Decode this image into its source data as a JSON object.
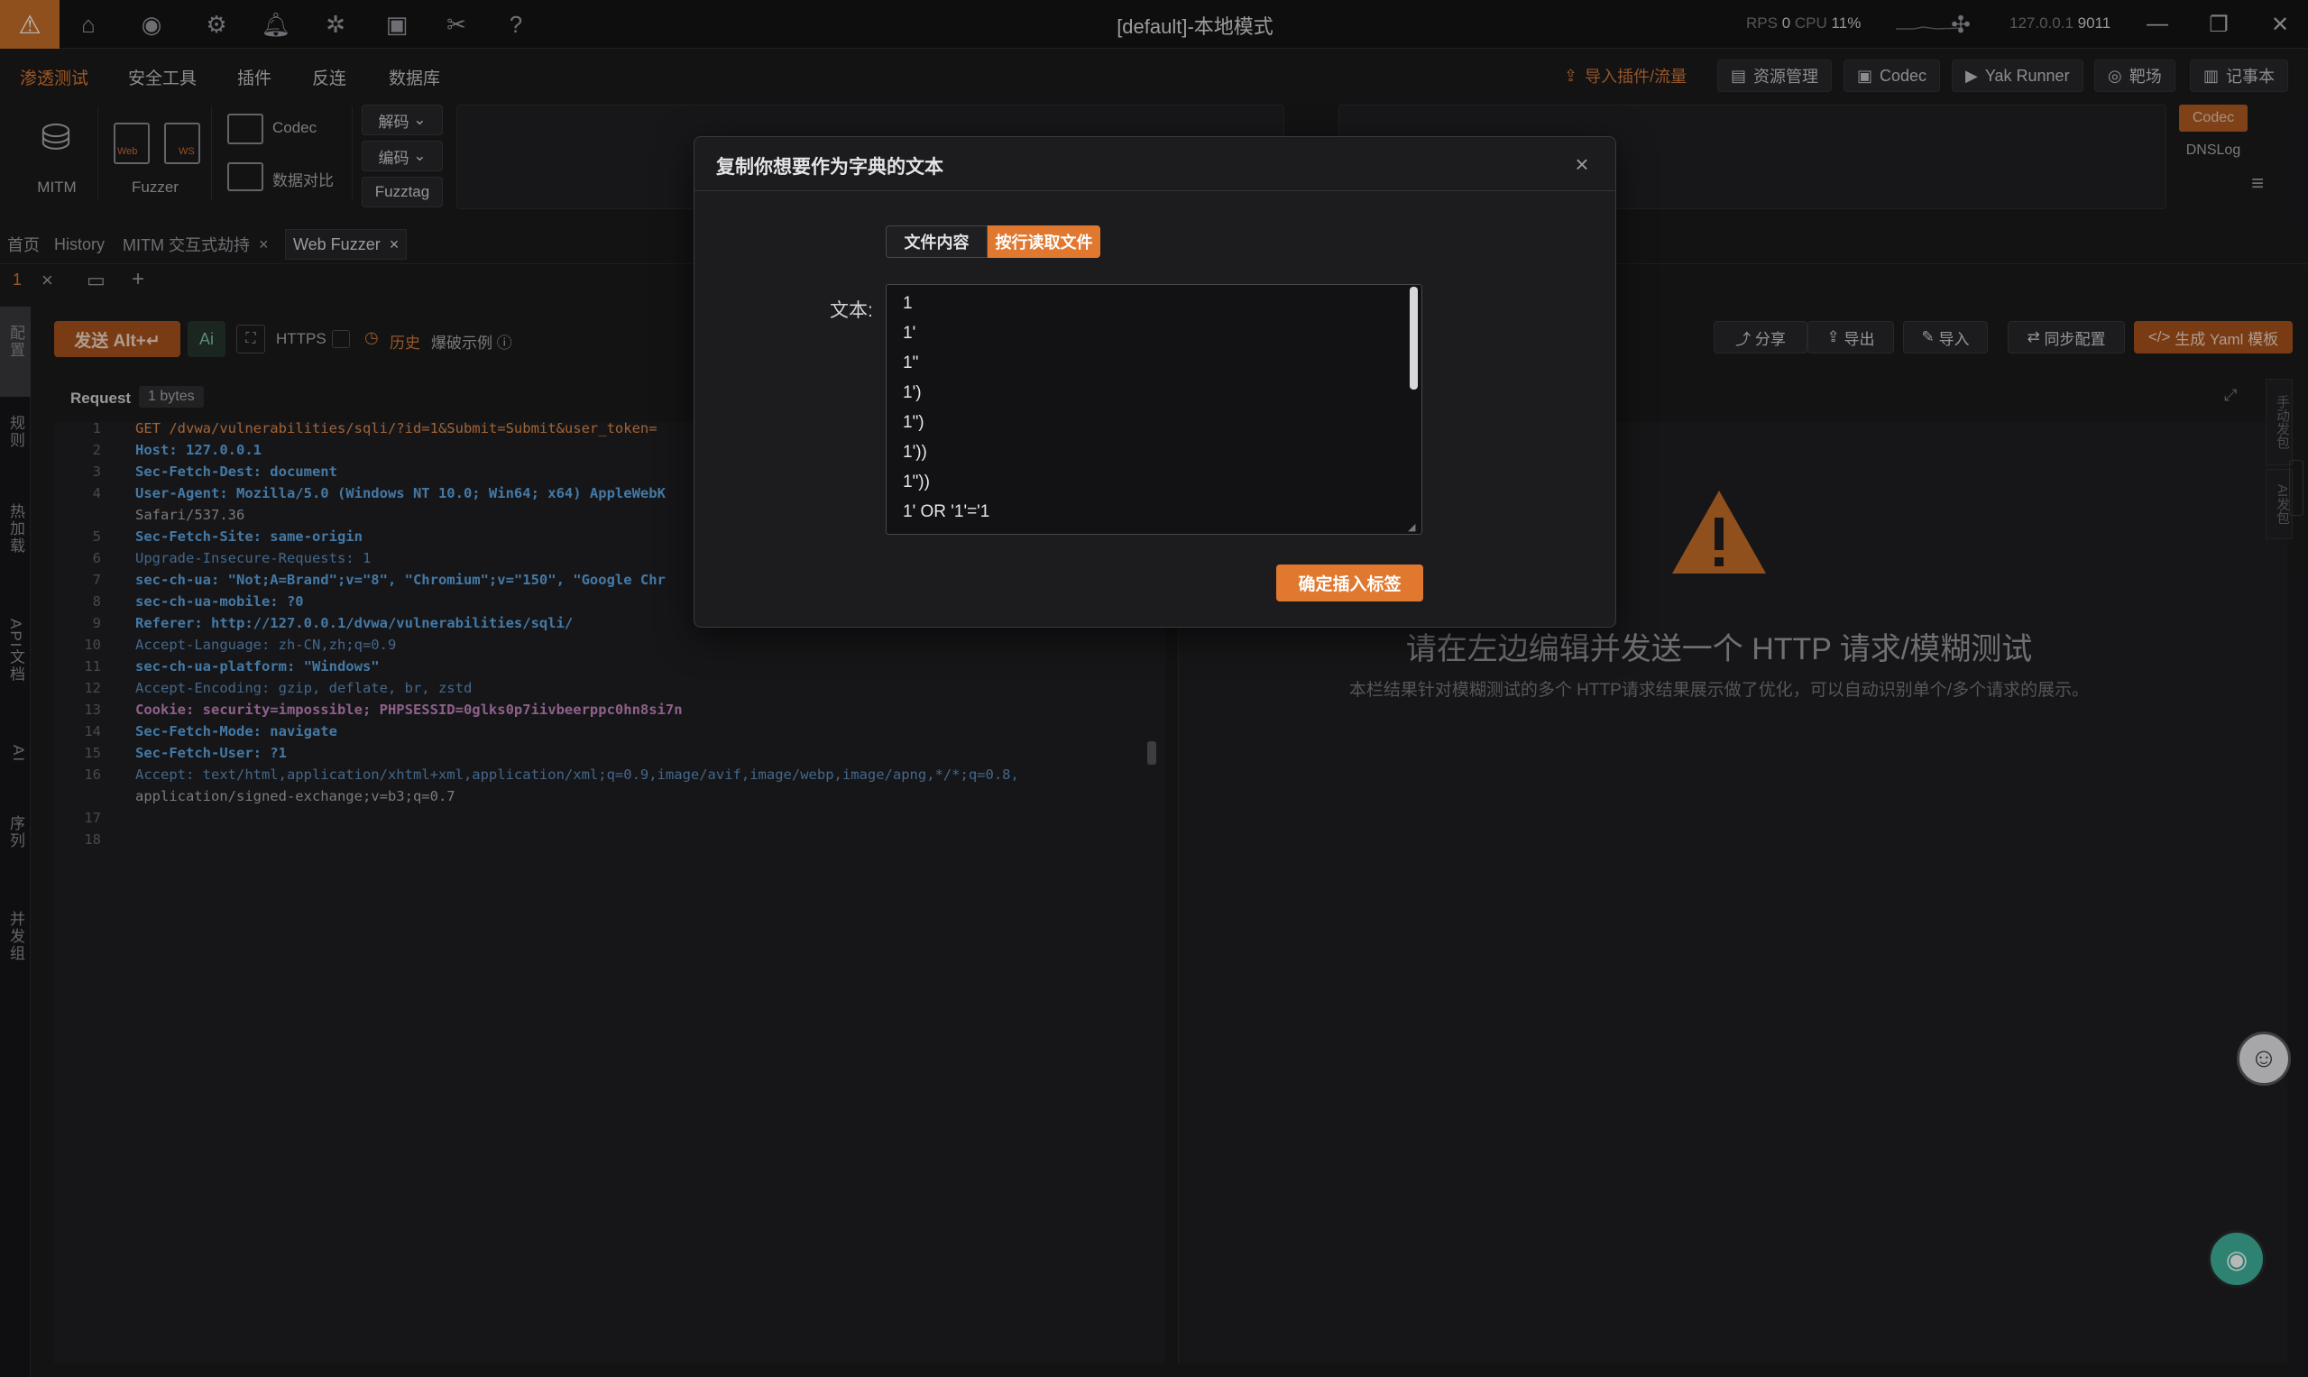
{
  "titlebar": {
    "title": "[default]-本地模式",
    "rps_label": "RPS",
    "rps_value": "0",
    "cpu_label": "CPU",
    "cpu_value": "11%",
    "host": "127.0.0.1",
    "port": "9011"
  },
  "menu": {
    "items": [
      "渗透测试",
      "安全工具",
      "插件",
      "反连",
      "数据库"
    ],
    "right_buttons": [
      "导入插件/流量",
      "资源管理",
      "Codec",
      "Yak Runner",
      "靶场",
      "记事本"
    ]
  },
  "toolbar": {
    "mitm": "MITM",
    "fuzzer": "Fuzzer",
    "web": "Web",
    "ws": "WS",
    "codec": "Codec",
    "compare": "数据对比",
    "decode": "解码",
    "encode": "编码",
    "fuzztag": "Fuzztag",
    "side_codec": "Codec",
    "side_dnslog": "DNSLog"
  },
  "tabs": {
    "items": [
      "首页",
      "History",
      "MITM 交互式劫持",
      "Web Fuzzer"
    ],
    "sub_index": "1"
  },
  "fuzzer_bar": {
    "send": "发送 Alt+↵",
    "ai": "Ai",
    "https": "HTTPS",
    "history": "历史",
    "example": "爆破示例",
    "share": "分享",
    "export": "导出",
    "import": "导入",
    "sync": "同步配置",
    "yaml": "生成 Yaml 模板"
  },
  "sidebar": {
    "items": [
      "配置",
      "规则",
      "热加载",
      "API文档",
      "AI",
      "序列",
      "并发组"
    ]
  },
  "request": {
    "title": "Request",
    "bytes": "1 bytes",
    "lines": [
      "GET /dvwa/vulnerabilities/sqli/?id=1&Submit=Submit&user_token=",
      "Host: 127.0.0.1",
      "Sec-Fetch-Dest: document",
      "User-Agent: Mozilla/5.0 (Windows NT 10.0; Win64; x64) AppleWebK",
      "Safari/537.36",
      "Sec-Fetch-Site: same-origin",
      "Upgrade-Insecure-Requests: 1",
      "sec-ch-ua: \"Not;A=Brand\";v=\"8\", \"Chromium\";v=\"150\", \"Google Chr",
      "sec-ch-ua-mobile: ?0",
      "Referer: http://127.0.0.1/dvwa/vulnerabilities/sqli/",
      "Accept-Language: zh-CN,zh;q=0.9",
      "sec-ch-ua-platform: \"Windows\"",
      "Accept-Encoding: gzip, deflate, br, zstd",
      "Cookie: security=impossible; PHPSESSID=0glks0p7iivbeerppc0hn8si7n",
      "Sec-Fetch-Mode: navigate",
      "Sec-Fetch-User: ?1",
      "Accept: text/html,application/xhtml+xml,application/xml;q=0.9,image/avif,image/webp,image/apng,*/*;q=0.8,",
      "application/signed-exchange;v=b3;q=0.7"
    ],
    "line_numbers": [
      "1",
      "2",
      "3",
      "4",
      "",
      "5",
      "6",
      "7",
      "8",
      "9",
      "10",
      "11",
      "12",
      "13",
      "14",
      "15",
      "16",
      "",
      "17",
      "18"
    ]
  },
  "response": {
    "empty_title": "请在左边编辑并发送一个 HTTP 请求/模糊测试",
    "empty_desc": "本栏结果针对模糊测试的多个 HTTP请求结果展示做了优化，可以自动识别单个/多个请求的展示。",
    "side_tab1": "手动发包",
    "side_tab2": "AI发包"
  },
  "modal": {
    "title": "复制你想要作为字典的文本",
    "seg_file_content": "文件内容",
    "seg_read_by_line": "按行读取文件",
    "text_label": "文本:",
    "text_lines": [
      "1",
      "1'",
      "1\"",
      "1')",
      "1\")",
      "1'))",
      "1\"))",
      "1' OR '1'='1"
    ],
    "confirm": "确定插入标签"
  }
}
